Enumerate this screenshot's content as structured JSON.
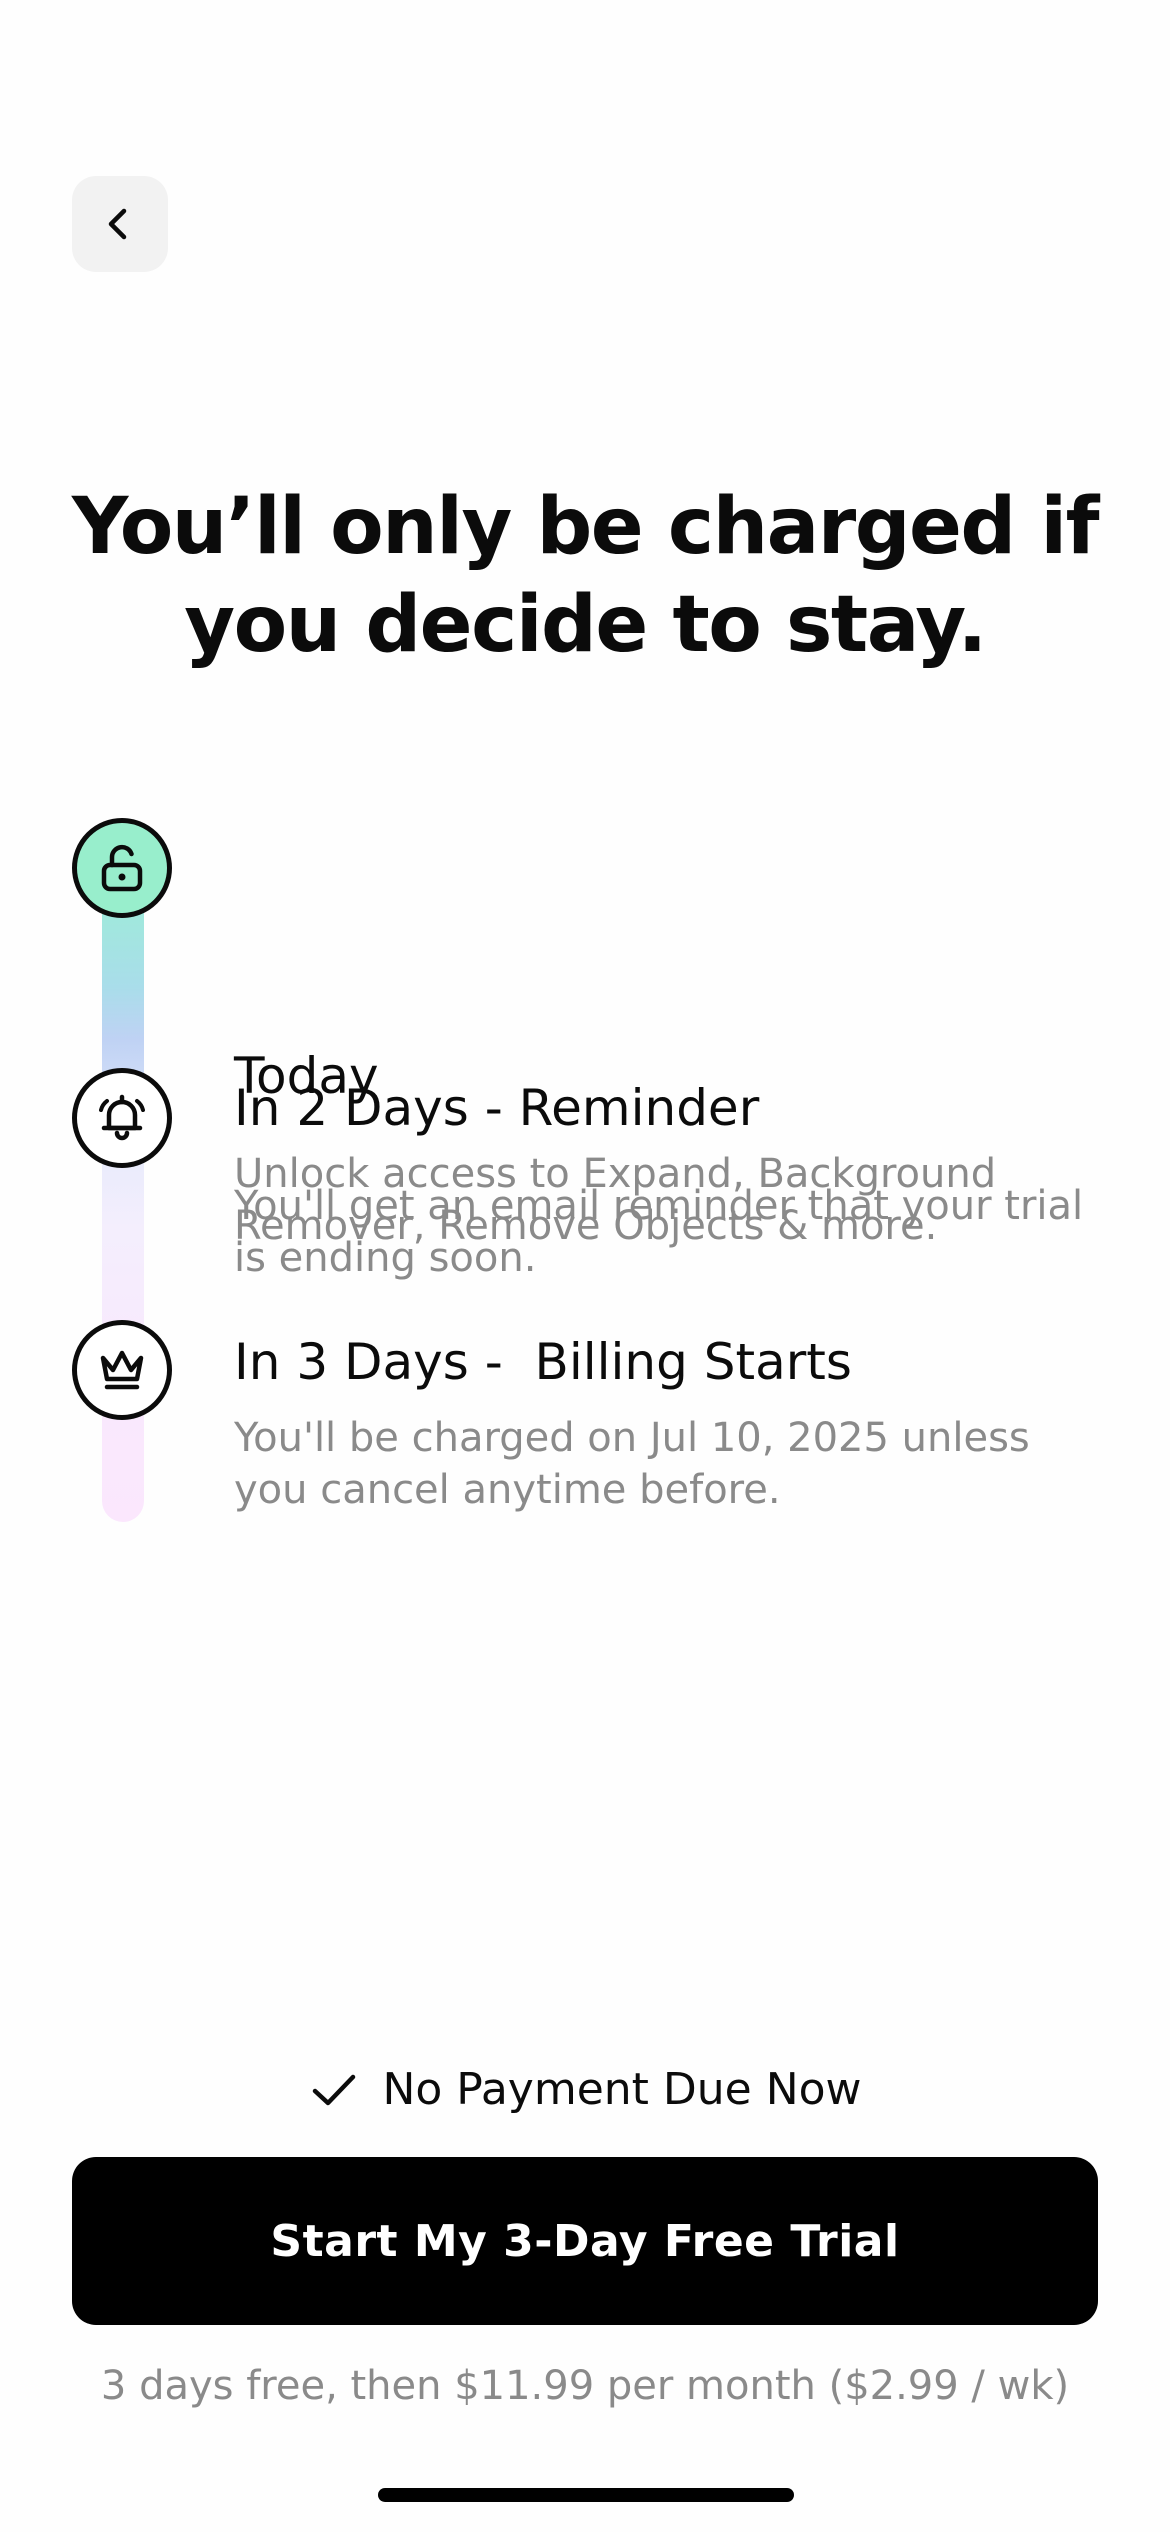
{
  "nav": {
    "back_icon": "chevron-left-icon"
  },
  "headline": "You’ll only be charged if you decide to stay.",
  "timeline": {
    "steps": [
      {
        "icon": "unlock-icon",
        "title": "Today",
        "description": "Unlock access to Expand, Background Remover, Remove Objects & more."
      },
      {
        "icon": "bell-icon",
        "title": "In 2 Days - Reminder",
        "description": "You'll get an email reminder that your trial is ending soon."
      },
      {
        "icon": "crown-icon",
        "title": "In 3 Days -  Billing Starts",
        "description": "You'll be charged on Jul 10, 2025 unless you cancel anytime before."
      }
    ],
    "colors": {
      "today_icon_bg": "#98EECC",
      "bar_gradient": [
        "#9BEFD4",
        "#BFD2F4",
        "#F4EEFD",
        "#FBE7FD"
      ]
    }
  },
  "footer": {
    "check_icon": "checkmark-icon",
    "no_payment_text": "No Payment Due Now",
    "cta_label": "Start My 3-Day Free Trial",
    "pricing_text": "3 days free, then $11.99 per month ($2.99 / wk)"
  }
}
